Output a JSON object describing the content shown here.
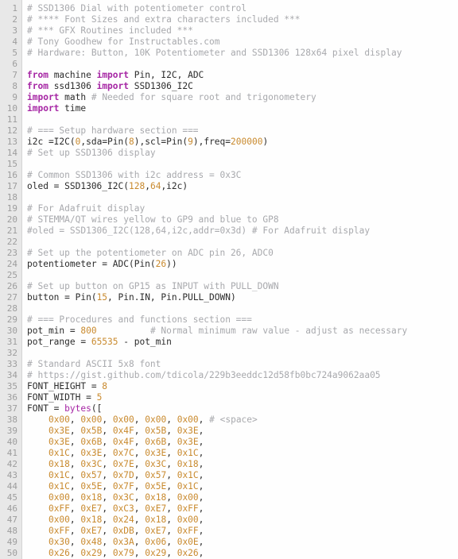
{
  "editor": {
    "language": "python",
    "colors": {
      "background": "#fefefe",
      "gutter_background": "#e8e8e8",
      "gutter_text": "#9d9d9d",
      "comment": "#a8a9ad",
      "keyword": "#a626a4",
      "number": "#c98a2e",
      "identifier": "#2b2b2b"
    },
    "first_line": 1,
    "last_line": 50,
    "total_visible_lines": 50
  },
  "lines": [
    {
      "n": "1",
      "tokens": [
        {
          "t": "com",
          "s": "# SSD1306 Dial with potentiometer control"
        }
      ]
    },
    {
      "n": "2",
      "tokens": [
        {
          "t": "com",
          "s": "# **** Font Sizes and extra characters included ***"
        }
      ]
    },
    {
      "n": "3",
      "tokens": [
        {
          "t": "com",
          "s": "# *** GFX Routines included ***"
        }
      ]
    },
    {
      "n": "4",
      "tokens": [
        {
          "t": "com",
          "s": "# Tony Goodhew for Instructables.com"
        }
      ]
    },
    {
      "n": "5",
      "tokens": [
        {
          "t": "com",
          "s": "# Hardware: Button, 10K Potentiometer and SSD1306 128x64 pixel display"
        }
      ]
    },
    {
      "n": "6",
      "tokens": []
    },
    {
      "n": "7",
      "tokens": [
        {
          "t": "kw",
          "s": "from"
        },
        {
          "t": "id",
          "s": " machine "
        },
        {
          "t": "kw",
          "s": "import"
        },
        {
          "t": "id",
          "s": " Pin, I2C, ADC"
        }
      ]
    },
    {
      "n": "8",
      "tokens": [
        {
          "t": "kw",
          "s": "from"
        },
        {
          "t": "id",
          "s": " ssd1306 "
        },
        {
          "t": "kw",
          "s": "import"
        },
        {
          "t": "id",
          "s": " SSD1306_I2C"
        }
      ]
    },
    {
      "n": "9",
      "tokens": [
        {
          "t": "kw",
          "s": "import"
        },
        {
          "t": "id",
          "s": " math "
        },
        {
          "t": "com",
          "s": "# Needed for square root and trigonometery"
        }
      ]
    },
    {
      "n": "10",
      "tokens": [
        {
          "t": "kw",
          "s": "import"
        },
        {
          "t": "id",
          "s": " time"
        }
      ]
    },
    {
      "n": "11",
      "tokens": []
    },
    {
      "n": "12",
      "tokens": [
        {
          "t": "com",
          "s": "# === Setup hardware section ==="
        }
      ]
    },
    {
      "n": "13",
      "tokens": [
        {
          "t": "id",
          "s": "i2c =I2C("
        },
        {
          "t": "num",
          "s": "0"
        },
        {
          "t": "id",
          "s": ",sda=Pin("
        },
        {
          "t": "num",
          "s": "8"
        },
        {
          "t": "id",
          "s": "),scl=Pin("
        },
        {
          "t": "num",
          "s": "9"
        },
        {
          "t": "id",
          "s": "),freq="
        },
        {
          "t": "num",
          "s": "200000"
        },
        {
          "t": "id",
          "s": ")"
        }
      ]
    },
    {
      "n": "14",
      "tokens": [
        {
          "t": "com",
          "s": "# Set up SSD1306 display"
        }
      ]
    },
    {
      "n": "15",
      "tokens": []
    },
    {
      "n": "16",
      "tokens": [
        {
          "t": "com",
          "s": "# Common SSD1306 with i2c address = 0x3C"
        }
      ]
    },
    {
      "n": "17",
      "tokens": [
        {
          "t": "id",
          "s": "oled = SSD1306_I2C("
        },
        {
          "t": "num",
          "s": "128"
        },
        {
          "t": "id",
          "s": ","
        },
        {
          "t": "num",
          "s": "64"
        },
        {
          "t": "id",
          "s": ",i2c)"
        }
      ]
    },
    {
      "n": "18",
      "tokens": []
    },
    {
      "n": "19",
      "tokens": [
        {
          "t": "com",
          "s": "# For Adafruit display"
        }
      ]
    },
    {
      "n": "20",
      "tokens": [
        {
          "t": "com",
          "s": "# STEMMA/QT wires yellow to GP9 and blue to GP8"
        }
      ]
    },
    {
      "n": "21",
      "tokens": [
        {
          "t": "com",
          "s": "#oled = SSD1306_I2C(128,64,i2c,addr=0x3d) # For Adafruit display"
        }
      ]
    },
    {
      "n": "22",
      "tokens": []
    },
    {
      "n": "23",
      "tokens": [
        {
          "t": "com",
          "s": "# Set up the potentiometer on ADC pin 26, ADC0"
        }
      ]
    },
    {
      "n": "24",
      "tokens": [
        {
          "t": "id",
          "s": "potentiometer = ADC(Pin("
        },
        {
          "t": "num",
          "s": "26"
        },
        {
          "t": "id",
          "s": "))"
        }
      ]
    },
    {
      "n": "25",
      "tokens": []
    },
    {
      "n": "26",
      "tokens": [
        {
          "t": "com",
          "s": "# Set up button on GP15 as INPUT with PULL_DOWN"
        }
      ]
    },
    {
      "n": "27",
      "tokens": [
        {
          "t": "id",
          "s": "button = Pin("
        },
        {
          "t": "num",
          "s": "15"
        },
        {
          "t": "id",
          "s": ", Pin.IN, Pin.PULL_DOWN)"
        }
      ]
    },
    {
      "n": "28",
      "tokens": []
    },
    {
      "n": "29",
      "tokens": [
        {
          "t": "com",
          "s": "# === Procedures and functions section ==="
        }
      ]
    },
    {
      "n": "30",
      "tokens": [
        {
          "t": "id",
          "s": "pot_min = "
        },
        {
          "t": "num",
          "s": "800"
        },
        {
          "t": "id",
          "s": "          "
        },
        {
          "t": "com",
          "s": "# Normal minimum raw value - adjust as necessary"
        }
      ]
    },
    {
      "n": "31",
      "tokens": [
        {
          "t": "id",
          "s": "pot_range = "
        },
        {
          "t": "num",
          "s": "65535"
        },
        {
          "t": "id",
          "s": " - pot_min"
        }
      ]
    },
    {
      "n": "32",
      "tokens": []
    },
    {
      "n": "33",
      "tokens": [
        {
          "t": "com",
          "s": "# Standard ASCII 5x8 font"
        }
      ]
    },
    {
      "n": "34",
      "tokens": [
        {
          "t": "com",
          "s": "# https://gist.github.com/tdicola/229b3eeddc12d58fb0bc724a9062aa05"
        }
      ]
    },
    {
      "n": "35",
      "tokens": [
        {
          "t": "id",
          "s": "FONT_HEIGHT = "
        },
        {
          "t": "num",
          "s": "8"
        }
      ]
    },
    {
      "n": "36",
      "tokens": [
        {
          "t": "id",
          "s": "FONT_WIDTH = "
        },
        {
          "t": "num",
          "s": "5"
        }
      ]
    },
    {
      "n": "37",
      "tokens": [
        {
          "t": "id",
          "s": "FONT = "
        },
        {
          "t": "bi",
          "s": "bytes"
        },
        {
          "t": "id",
          "s": "(["
        }
      ]
    },
    {
      "n": "38",
      "tokens": [
        {
          "t": "id",
          "s": "    "
        },
        {
          "t": "num",
          "s": "0x00"
        },
        {
          "t": "id",
          "s": ", "
        },
        {
          "t": "num",
          "s": "0x00"
        },
        {
          "t": "id",
          "s": ", "
        },
        {
          "t": "num",
          "s": "0x00"
        },
        {
          "t": "id",
          "s": ", "
        },
        {
          "t": "num",
          "s": "0x00"
        },
        {
          "t": "id",
          "s": ", "
        },
        {
          "t": "num",
          "s": "0x00"
        },
        {
          "t": "id",
          "s": ", "
        },
        {
          "t": "com",
          "s": "# <space>"
        }
      ]
    },
    {
      "n": "39",
      "tokens": [
        {
          "t": "id",
          "s": "    "
        },
        {
          "t": "num",
          "s": "0x3E"
        },
        {
          "t": "id",
          "s": ", "
        },
        {
          "t": "num",
          "s": "0x5B"
        },
        {
          "t": "id",
          "s": ", "
        },
        {
          "t": "num",
          "s": "0x4F"
        },
        {
          "t": "id",
          "s": ", "
        },
        {
          "t": "num",
          "s": "0x5B"
        },
        {
          "t": "id",
          "s": ", "
        },
        {
          "t": "num",
          "s": "0x3E"
        },
        {
          "t": "id",
          "s": ","
        }
      ]
    },
    {
      "n": "40",
      "tokens": [
        {
          "t": "id",
          "s": "    "
        },
        {
          "t": "num",
          "s": "0x3E"
        },
        {
          "t": "id",
          "s": ", "
        },
        {
          "t": "num",
          "s": "0x6B"
        },
        {
          "t": "id",
          "s": ", "
        },
        {
          "t": "num",
          "s": "0x4F"
        },
        {
          "t": "id",
          "s": ", "
        },
        {
          "t": "num",
          "s": "0x6B"
        },
        {
          "t": "id",
          "s": ", "
        },
        {
          "t": "num",
          "s": "0x3E"
        },
        {
          "t": "id",
          "s": ","
        }
      ]
    },
    {
      "n": "41",
      "tokens": [
        {
          "t": "id",
          "s": "    "
        },
        {
          "t": "num",
          "s": "0x1C"
        },
        {
          "t": "id",
          "s": ", "
        },
        {
          "t": "num",
          "s": "0x3E"
        },
        {
          "t": "id",
          "s": ", "
        },
        {
          "t": "num",
          "s": "0x7C"
        },
        {
          "t": "id",
          "s": ", "
        },
        {
          "t": "num",
          "s": "0x3E"
        },
        {
          "t": "id",
          "s": ", "
        },
        {
          "t": "num",
          "s": "0x1C"
        },
        {
          "t": "id",
          "s": ","
        }
      ]
    },
    {
      "n": "42",
      "tokens": [
        {
          "t": "id",
          "s": "    "
        },
        {
          "t": "num",
          "s": "0x18"
        },
        {
          "t": "id",
          "s": ", "
        },
        {
          "t": "num",
          "s": "0x3C"
        },
        {
          "t": "id",
          "s": ", "
        },
        {
          "t": "num",
          "s": "0x7E"
        },
        {
          "t": "id",
          "s": ", "
        },
        {
          "t": "num",
          "s": "0x3C"
        },
        {
          "t": "id",
          "s": ", "
        },
        {
          "t": "num",
          "s": "0x18"
        },
        {
          "t": "id",
          "s": ","
        }
      ]
    },
    {
      "n": "43",
      "tokens": [
        {
          "t": "id",
          "s": "    "
        },
        {
          "t": "num",
          "s": "0x1C"
        },
        {
          "t": "id",
          "s": ", "
        },
        {
          "t": "num",
          "s": "0x57"
        },
        {
          "t": "id",
          "s": ", "
        },
        {
          "t": "num",
          "s": "0x7D"
        },
        {
          "t": "id",
          "s": ", "
        },
        {
          "t": "num",
          "s": "0x57"
        },
        {
          "t": "id",
          "s": ", "
        },
        {
          "t": "num",
          "s": "0x1C"
        },
        {
          "t": "id",
          "s": ","
        }
      ]
    },
    {
      "n": "44",
      "tokens": [
        {
          "t": "id",
          "s": "    "
        },
        {
          "t": "num",
          "s": "0x1C"
        },
        {
          "t": "id",
          "s": ", "
        },
        {
          "t": "num",
          "s": "0x5E"
        },
        {
          "t": "id",
          "s": ", "
        },
        {
          "t": "num",
          "s": "0x7F"
        },
        {
          "t": "id",
          "s": ", "
        },
        {
          "t": "num",
          "s": "0x5E"
        },
        {
          "t": "id",
          "s": ", "
        },
        {
          "t": "num",
          "s": "0x1C"
        },
        {
          "t": "id",
          "s": ","
        }
      ]
    },
    {
      "n": "45",
      "tokens": [
        {
          "t": "id",
          "s": "    "
        },
        {
          "t": "num",
          "s": "0x00"
        },
        {
          "t": "id",
          "s": ", "
        },
        {
          "t": "num",
          "s": "0x18"
        },
        {
          "t": "id",
          "s": ", "
        },
        {
          "t": "num",
          "s": "0x3C"
        },
        {
          "t": "id",
          "s": ", "
        },
        {
          "t": "num",
          "s": "0x18"
        },
        {
          "t": "id",
          "s": ", "
        },
        {
          "t": "num",
          "s": "0x00"
        },
        {
          "t": "id",
          "s": ","
        }
      ]
    },
    {
      "n": "46",
      "tokens": [
        {
          "t": "id",
          "s": "    "
        },
        {
          "t": "num",
          "s": "0xFF"
        },
        {
          "t": "id",
          "s": ", "
        },
        {
          "t": "num",
          "s": "0xE7"
        },
        {
          "t": "id",
          "s": ", "
        },
        {
          "t": "num",
          "s": "0xC3"
        },
        {
          "t": "id",
          "s": ", "
        },
        {
          "t": "num",
          "s": "0xE7"
        },
        {
          "t": "id",
          "s": ", "
        },
        {
          "t": "num",
          "s": "0xFF"
        },
        {
          "t": "id",
          "s": ","
        }
      ]
    },
    {
      "n": "47",
      "tokens": [
        {
          "t": "id",
          "s": "    "
        },
        {
          "t": "num",
          "s": "0x00"
        },
        {
          "t": "id",
          "s": ", "
        },
        {
          "t": "num",
          "s": "0x18"
        },
        {
          "t": "id",
          "s": ", "
        },
        {
          "t": "num",
          "s": "0x24"
        },
        {
          "t": "id",
          "s": ", "
        },
        {
          "t": "num",
          "s": "0x18"
        },
        {
          "t": "id",
          "s": ", "
        },
        {
          "t": "num",
          "s": "0x00"
        },
        {
          "t": "id",
          "s": ","
        }
      ]
    },
    {
      "n": "48",
      "tokens": [
        {
          "t": "id",
          "s": "    "
        },
        {
          "t": "num",
          "s": "0xFF"
        },
        {
          "t": "id",
          "s": ", "
        },
        {
          "t": "num",
          "s": "0xE7"
        },
        {
          "t": "id",
          "s": ", "
        },
        {
          "t": "num",
          "s": "0xDB"
        },
        {
          "t": "id",
          "s": ", "
        },
        {
          "t": "num",
          "s": "0xE7"
        },
        {
          "t": "id",
          "s": ", "
        },
        {
          "t": "num",
          "s": "0xFF"
        },
        {
          "t": "id",
          "s": ","
        }
      ]
    },
    {
      "n": "49",
      "tokens": [
        {
          "t": "id",
          "s": "    "
        },
        {
          "t": "num",
          "s": "0x30"
        },
        {
          "t": "id",
          "s": ", "
        },
        {
          "t": "num",
          "s": "0x48"
        },
        {
          "t": "id",
          "s": ", "
        },
        {
          "t": "num",
          "s": "0x3A"
        },
        {
          "t": "id",
          "s": ", "
        },
        {
          "t": "num",
          "s": "0x06"
        },
        {
          "t": "id",
          "s": ", "
        },
        {
          "t": "num",
          "s": "0x0E"
        },
        {
          "t": "id",
          "s": ","
        }
      ]
    },
    {
      "n": "50",
      "tokens": [
        {
          "t": "id",
          "s": "    "
        },
        {
          "t": "num",
          "s": "0x26"
        },
        {
          "t": "id",
          "s": ", "
        },
        {
          "t": "num",
          "s": "0x29"
        },
        {
          "t": "id",
          "s": ", "
        },
        {
          "t": "num",
          "s": "0x79"
        },
        {
          "t": "id",
          "s": ", "
        },
        {
          "t": "num",
          "s": "0x29"
        },
        {
          "t": "id",
          "s": ", "
        },
        {
          "t": "num",
          "s": "0x26"
        },
        {
          "t": "id",
          "s": ","
        }
      ]
    }
  ]
}
